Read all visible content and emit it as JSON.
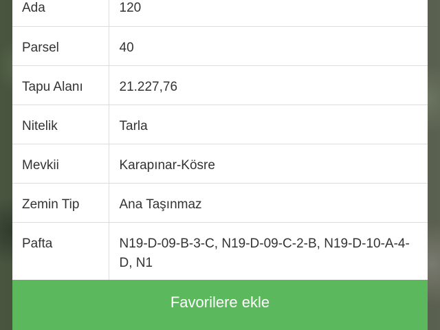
{
  "parcel_info": {
    "rows": [
      {
        "label": "Ada",
        "value": "120"
      },
      {
        "label": "Parsel",
        "value": "40"
      },
      {
        "label": "Tapu Alanı",
        "value": "21.227,76"
      },
      {
        "label": "Nitelik",
        "value": "Tarla"
      },
      {
        "label": "Mevkii",
        "value": "Karapınar-Kösre"
      },
      {
        "label": "Zemin Tip",
        "value": "Ana Taşınmaz"
      },
      {
        "label": "Pafta",
        "value": "N19-D-09-B-3-C, N19-D-09-C-2-B, N19-D-10-A-4-D, N1"
      }
    ]
  },
  "actions": {
    "favorite_label": "Favorilere ekle"
  },
  "colors": {
    "button_green": "#5cb85c",
    "panel_bg": "#ffffff",
    "text": "#333333",
    "divider": "#dcdcdc"
  }
}
